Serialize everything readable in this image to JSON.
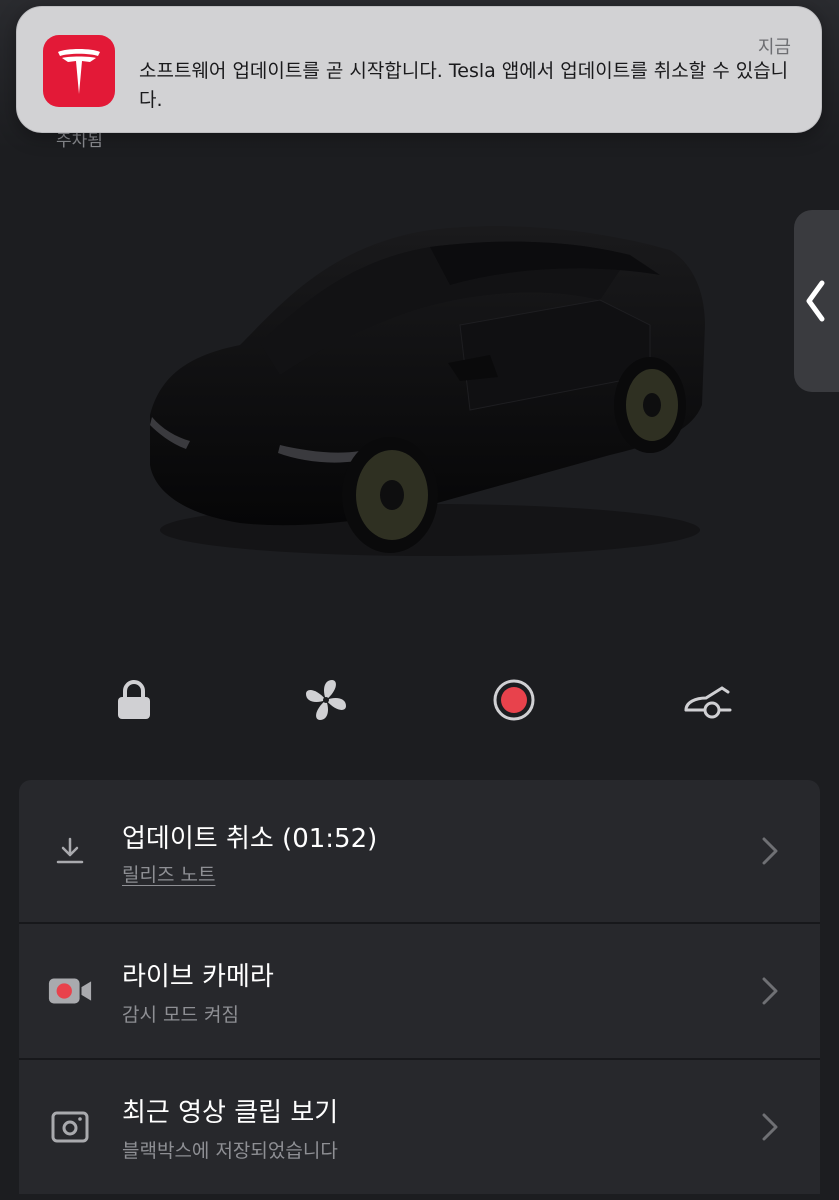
{
  "notification": {
    "app_icon": "tesla-logo-icon",
    "time": "지금",
    "message": "소프트웨어 업데이트를 곧 시작합니다. Tesla 앱에서 업데이트를 취소할 수 있습니다."
  },
  "underlay_text": "주차됨",
  "side_tab": {
    "icon": "chevron-left-icon"
  },
  "quick_controls": [
    {
      "icon": "lock-icon"
    },
    {
      "icon": "fan-icon"
    },
    {
      "icon": "record-icon"
    },
    {
      "icon": "frunk-icon"
    }
  ],
  "colors": {
    "accent_red": "#e8424c",
    "tesla_red": "#e31937"
  },
  "list": [
    {
      "icon": "download-icon",
      "title": "업데이트 취소 (01:52)",
      "subtitle": "릴리즈 노트"
    },
    {
      "icon": "video-camera-icon",
      "title": "라이브 카메라",
      "subtitle": "감시 모드 켜짐"
    },
    {
      "icon": "photo-frame-icon",
      "title": "최근 영상 클립 보기",
      "subtitle": "블랙박스에 저장되었습니다"
    }
  ]
}
